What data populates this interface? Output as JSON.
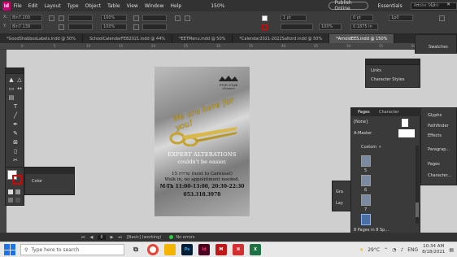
{
  "menubar": {
    "app_logo": "Id",
    "items": [
      "File",
      "Edit",
      "Layout",
      "Type",
      "Object",
      "Table",
      "View",
      "Window",
      "Help"
    ],
    "zoom": "150%",
    "publish": "Publish Online",
    "workspace": "Essentials",
    "search_placeholder": "Adobe Stock"
  },
  "control": {
    "x_label": "X:",
    "x_value": "8in7.200",
    "y_label": "Y:",
    "y_value": "8in7.139",
    "stroke": "1 pt",
    "percent": "100%",
    "pt_value": "0 pt",
    "size_value": "0.1875 in",
    "frame_value": "1p0"
  },
  "tabs": [
    {
      "label": "*GoodShabbosLabels.indd @ 50%",
      "active": false
    },
    {
      "label": "SchoolCalendarFEB2021.indd @ 44%",
      "active": false
    },
    {
      "label": "*EETMenu.indd @ 50%",
      "active": false
    },
    {
      "label": "*Calendar2021-2022Saltord.indd @ 50%",
      "active": false
    },
    {
      "label": "*ArnoldEES.indd @ 150%",
      "active": true
    }
  ],
  "ruler": {
    "marks": [
      "0",
      "5",
      "10",
      "15",
      "20",
      "25",
      "30",
      "35",
      "40",
      "45",
      "50",
      "55",
      "60"
    ]
  },
  "document": {
    "logo_title": "FIVE STAR",
    "logo_tagline": "cleaners",
    "script_text": "We are here for you!",
    "line1": "EXPERT ALTERATIONS",
    "line2": "couldn't be easier.",
    "line3": "15 שדרות (next to Carousel)",
    "line4": "Walk in, no appointment needed.",
    "line5": "M-Th 11:00-13:00, 20:30-22:30",
    "line6": "053.318.3978"
  },
  "panels": {
    "swatches": "Swatches",
    "links": "Links",
    "char_styles": "Character Styles",
    "glyphs": "Glyphs",
    "pathfinder": "Pathfinder",
    "effects": "Effects",
    "paragraph": "Paragrap...",
    "pages": "Pages",
    "character": "Character...",
    "color": "Color",
    "gradient": "Gra",
    "layers": "Lay"
  },
  "pages_panel": {
    "tab_pages": "Pages",
    "tab_character": "Character",
    "none_label": "[None]",
    "master_label": "A-Master",
    "custom_label": "Custom",
    "page_numbers": [
      "5",
      "6",
      "7"
    ],
    "footer": "8 Pages in 8 Sp..."
  },
  "statusbar": {
    "page": "8",
    "mode": "[Basic] (working)",
    "errors": "No errors"
  },
  "taskbar": {
    "search_placeholder": "Type here to search",
    "temperature": "29°C",
    "language": "ENG",
    "time": "10:34 AM",
    "date": "8/18/2021"
  },
  "colors": {
    "indesign": "#c7006d",
    "chrome": "#fbbc05",
    "explorer": "#f4b400",
    "photoshop": "#001e36",
    "indesign_app": "#49021f",
    "mcafee": "#c01818",
    "pdf": "#d32f2f",
    "excel": "#1f7244"
  }
}
